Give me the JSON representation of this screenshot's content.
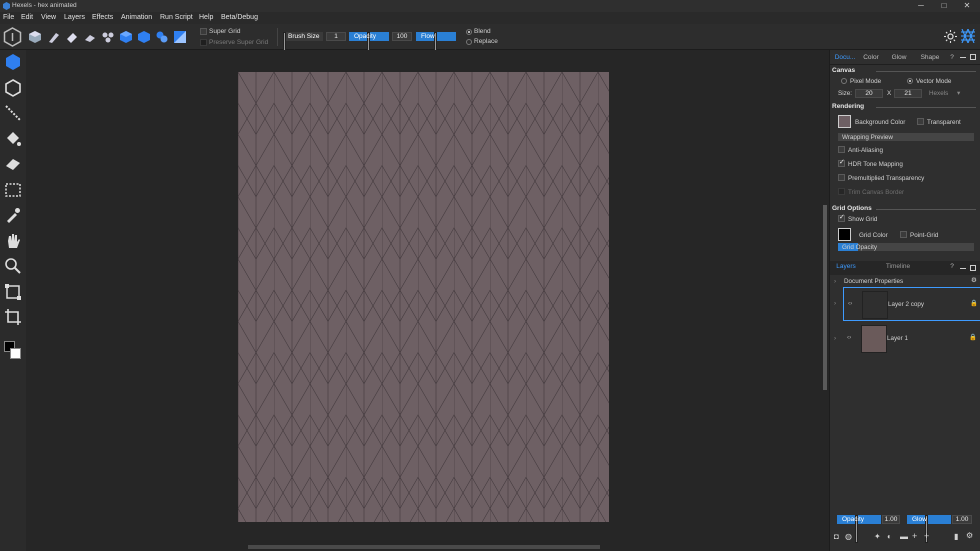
{
  "window": {
    "title": "Hexels - hex animated",
    "min": "─",
    "max": "□",
    "close": "✕"
  },
  "menu": [
    "File",
    "Edit",
    "View",
    "Layers",
    "Effects",
    "Animation",
    "Run Script",
    "Help",
    "Beta/Debug"
  ],
  "toolbar": {
    "super_grid": "Super Grid",
    "preserve_super_grid": "Preserve Super Grid",
    "brush_size_label": "Brush Size",
    "brush_size_value": "1",
    "opacity_label": "Opacity",
    "opacity_value": "100",
    "flow_label": "Flow",
    "blend_label": "Blend",
    "replace_label": "Replace"
  },
  "panel": {
    "tabs": [
      "Docu...",
      "Color",
      "Glow",
      "Shape"
    ],
    "help": "?",
    "canvas_section": "Canvas",
    "pixel_mode": "Pixel Mode",
    "vector_mode": "Vector Mode",
    "size_label": "Size:",
    "size_w": "20",
    "size_x": "X",
    "size_h": "21",
    "size_unit": "Hexels",
    "rendering_section": "Rendering",
    "background_color": "Background Color",
    "transparent": "Transparent",
    "wrapping_preview": "Wrapping Preview",
    "anti_aliasing": "Anti-Aliasing",
    "hdr_tone_mapping": "HDR Tone Mapping",
    "premultiplied": "Premultiplied Transparency",
    "trim_canvas": "Trim Canvas Border",
    "grid_section": "Grid Options",
    "show_grid": "Show Grid",
    "grid_color": "Grid Color",
    "point_grid": "Point-Grid",
    "grid_opacity": "Grid Opacity",
    "layers_tabs": [
      "Layers",
      "Timeline"
    ],
    "doc_properties": "Document Properties",
    "layers": [
      {
        "name": "Layer 2 copy"
      },
      {
        "name": "Layer 1"
      }
    ],
    "footer_opacity_label": "Opacity",
    "footer_opacity_value": "1.00",
    "footer_glow_label": "Glow",
    "footer_glow_value": "1.00"
  },
  "colors": {
    "accent": "#2a7fd4",
    "canvas_bg": "#6e6064",
    "grid_line": "#3e3539",
    "hex_tool": "#2f7ff0"
  }
}
